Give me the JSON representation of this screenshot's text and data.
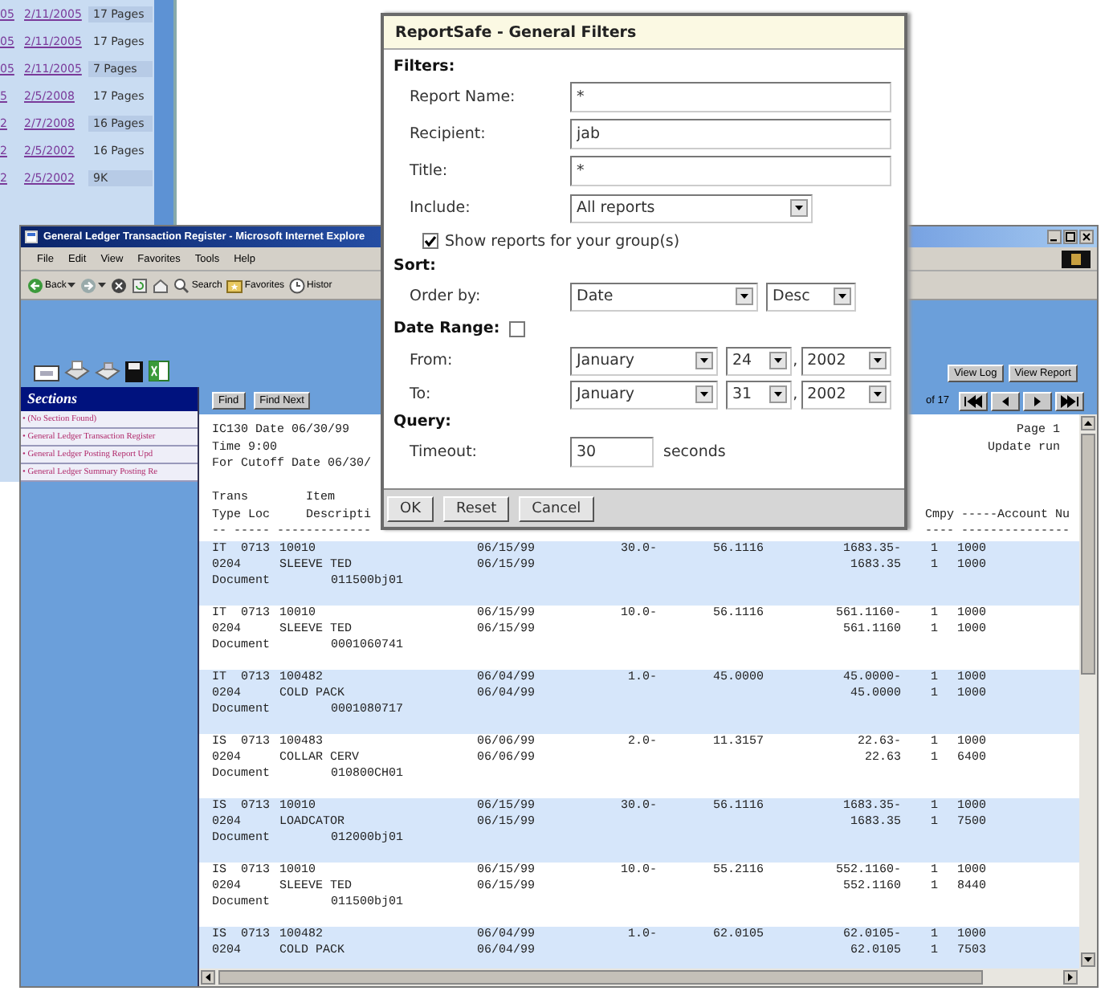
{
  "back_window": {
    "rows": [
      {
        "fragment": "05",
        "date": "2/11/2005",
        "size": "17 Pages"
      },
      {
        "fragment": "05",
        "date": "2/11/2005",
        "size": "17 Pages"
      },
      {
        "fragment": "05",
        "date": "2/11/2005",
        "size": "7 Pages"
      },
      {
        "fragment": "5",
        "date": "2/5/2008",
        "size": "17 Pages"
      },
      {
        "fragment": "2",
        "date": "2/7/2008",
        "size": "16 Pages"
      },
      {
        "fragment": "2",
        "date": "2/5/2002",
        "size": "16 Pages"
      },
      {
        "fragment": "2",
        "date": "2/5/2002",
        "size": "9K"
      }
    ]
  },
  "browser": {
    "title": "General Ledger Transaction Register - Microsoft Internet Explore",
    "menu": [
      "File",
      "Edit",
      "View",
      "Favorites",
      "Tools",
      "Help"
    ],
    "toolbar": [
      {
        "kind": "back",
        "label": "Back"
      },
      {
        "kind": "forward"
      },
      {
        "kind": "stop"
      },
      {
        "kind": "refresh"
      },
      {
        "kind": "home"
      },
      {
        "kind": "search",
        "label": "Search"
      },
      {
        "kind": "favorites",
        "label": "Favorites"
      },
      {
        "kind": "history",
        "label": "Histor"
      }
    ],
    "report_buttons": [
      "View Log",
      "View Report"
    ],
    "sections": {
      "title": "Sections",
      "items": [
        "• (No Section Found)",
        "• General Ledger Transaction Register",
        "• General Ledger Posting Report Upd",
        "• General Ledger Summary Posting Re"
      ]
    },
    "find_buttons": [
      "Find",
      "Find Next"
    ],
    "page_count": "of 17",
    "report": {
      "header": [
        {
          "left": "IC130 Date 06/30/99",
          "right": "Page 1"
        },
        {
          "left": "Time 9:00",
          "right": "Update run"
        },
        {
          "left": "For Cutoff Date 06/30/"
        }
      ],
      "column_header": [
        {
          "left": "Trans        Item"
        },
        {
          "left": "Type Loc     Descripti",
          "right": "Cmpy -----Account Nu"
        },
        {
          "left": "-- ----- -------------",
          "right": "---- ---------------"
        }
      ],
      "records": [
        {
          "line1": {
            "trans": "IT  0713",
            "item": "10010",
            "date": "06/15/99",
            "qty": "30.0-",
            "cost": "56.1116",
            "amount": "1683.35-",
            "cmpy": "1",
            "account": "1000"
          },
          "line2": {
            "trans": "0204",
            "item": "SLEEVE TED",
            "date": "06/15/99",
            "amount": "1683.35",
            "cmpy": "1",
            "account": "1000"
          },
          "document": {
            "label": "Document",
            "number": "011500bj01"
          }
        },
        {
          "line1": {
            "trans": "IT  0713",
            "item": "10010",
            "date": "06/15/99",
            "qty": "10.0-",
            "cost": "56.1116",
            "amount": "561.1160-",
            "cmpy": "1",
            "account": "1000"
          },
          "line2": {
            "trans": "0204",
            "item": "SLEEVE TED",
            "date": "06/15/99",
            "amount": "561.1160",
            "cmpy": "1",
            "account": "1000"
          },
          "document": {
            "label": "Document",
            "number": "0001060741"
          }
        },
        {
          "line1": {
            "trans": "IT  0713",
            "item": "100482",
            "date": "06/04/99",
            "qty": "1.0-",
            "cost": "45.0000",
            "amount": "45.0000-",
            "cmpy": "1",
            "account": "1000"
          },
          "line2": {
            "trans": "0204",
            "item": "COLD PACK",
            "date": "06/04/99",
            "amount": "45.0000",
            "cmpy": "1",
            "account": "1000"
          },
          "document": {
            "label": "Document",
            "number": "0001080717"
          }
        },
        {
          "line1": {
            "trans": "IS  0713",
            "item": "100483",
            "date": "06/06/99",
            "qty": "2.0-",
            "cost": "11.3157",
            "amount": "22.63-",
            "cmpy": "1",
            "account": "1000"
          },
          "line2": {
            "trans": "0204",
            "item": "COLLAR CERV",
            "date": "06/06/99",
            "amount": "22.63",
            "cmpy": "1",
            "account": "6400"
          },
          "document": {
            "label": "Document",
            "number": "010800CH01"
          }
        },
        {
          "line1": {
            "trans": "IS  0713",
            "item": "10010",
            "date": "06/15/99",
            "qty": "30.0-",
            "cost": "56.1116",
            "amount": "1683.35-",
            "cmpy": "1",
            "account": "1000"
          },
          "line2": {
            "trans": "0204",
            "item": "LOADCATOR",
            "date": "06/15/99",
            "amount": "1683.35",
            "cmpy": "1",
            "account": "7500"
          },
          "document": {
            "label": "Document",
            "number": "012000bj01"
          }
        },
        {
          "line1": {
            "trans": "IS  0713",
            "item": "10010",
            "date": "06/15/99",
            "qty": "10.0-",
            "cost": "55.2116",
            "amount": "552.1160-",
            "cmpy": "1",
            "account": "1000"
          },
          "line2": {
            "trans": "0204",
            "item": "SLEEVE TED",
            "date": "06/15/99",
            "amount": "552.1160",
            "cmpy": "1",
            "account": "8440"
          },
          "document": {
            "label": "Document",
            "number": "011500bj01"
          }
        },
        {
          "line1": {
            "trans": "IS  0713",
            "item": "100482",
            "date": "06/04/99",
            "qty": "1.0-",
            "cost": "62.0105",
            "amount": "62.0105-",
            "cmpy": "1",
            "account": "1000"
          },
          "line2": {
            "trans": "0204",
            "item": "COLD PACK",
            "date": "06/04/99",
            "amount": "62.0105",
            "cmpy": "1",
            "account": "7503"
          }
        }
      ]
    }
  },
  "dialog": {
    "title": "ReportSafe - General Filters",
    "filters": {
      "heading": "Filters:",
      "fields": [
        {
          "label": "Report Name:",
          "value": "*"
        },
        {
          "label": "Recipient:",
          "value": "jab"
        },
        {
          "label": "Title:",
          "value": "*"
        }
      ],
      "include": {
        "label": "Include:",
        "value": "All reports"
      },
      "group_option": {
        "label": "Show reports for your group(s)",
        "checked": true
      }
    },
    "sort": {
      "heading": "Sort:",
      "label": "Order by:",
      "field": "Date",
      "direction": "Desc"
    },
    "date_range": {
      "heading": "Date Range:",
      "checked": false,
      "rows": [
        {
          "label": "From:",
          "month": "January",
          "day": "24",
          "separator": ",",
          "year": "2002"
        },
        {
          "label": "To:",
          "month": "January",
          "day": "31",
          "separator": ",",
          "year": "2002"
        }
      ]
    },
    "query": {
      "heading": "Query:",
      "label": "Timeout:",
      "value": "30",
      "unit": "seconds"
    },
    "buttons": [
      "OK",
      "Reset",
      "Cancel"
    ]
  }
}
